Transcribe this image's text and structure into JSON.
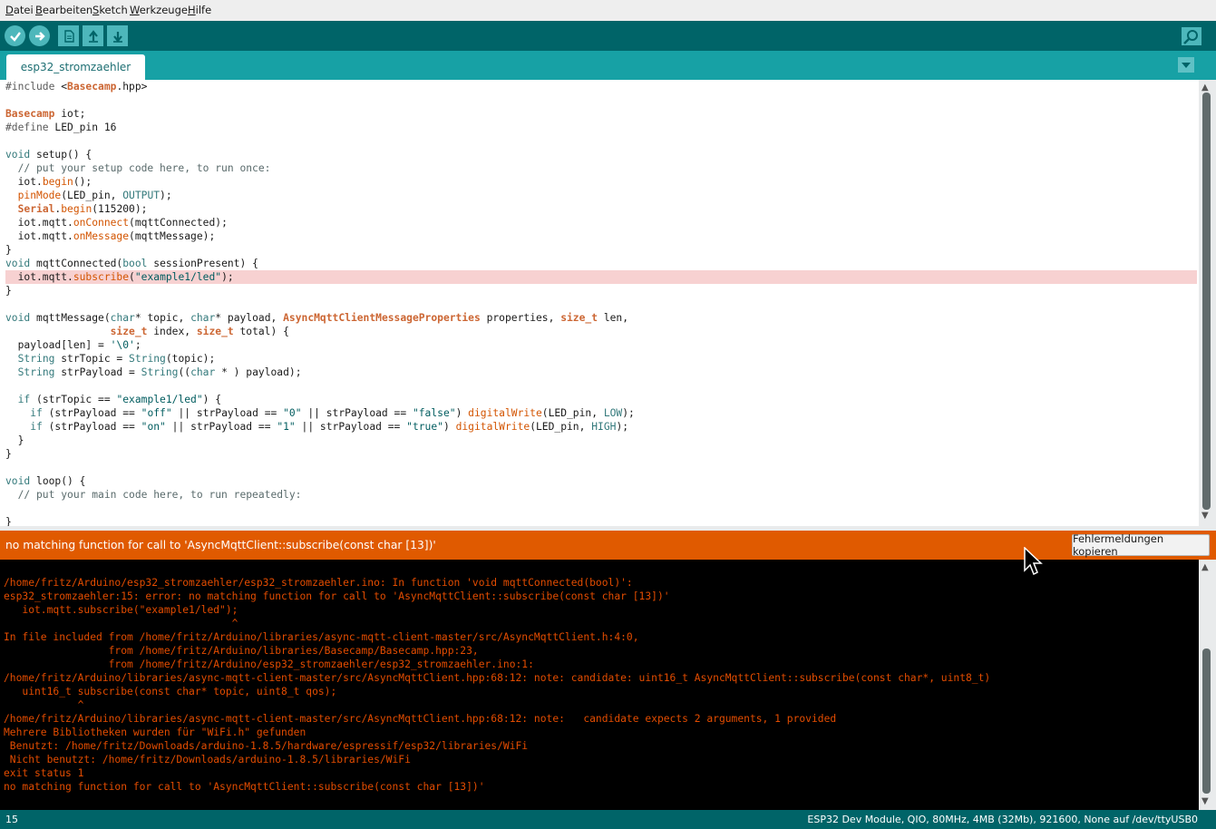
{
  "menu": [
    "Datei",
    "Bearbeiten",
    "Sketch",
    "Werkzeuge",
    "Hilfe"
  ],
  "toolbar": {
    "verify": "check-icon",
    "upload": "arrow-right-icon",
    "new": "new-file-icon",
    "open": "arrow-up-icon",
    "save": "arrow-down-icon",
    "serial_monitor": "magnifier-icon"
  },
  "tab": {
    "name": "esp32_stromzaehler"
  },
  "code": [
    "#include <Basecamp.hpp>",
    "",
    "Basecamp iot;",
    "#define LED_pin 16",
    "",
    "void setup() {",
    "  // put your setup code here, to run once:",
    "  iot.begin();",
    "  pinMode(LED_pin, OUTPUT);",
    "  Serial.begin(115200);",
    "  iot.mqtt.onConnect(mqttConnected);",
    "  iot.mqtt.onMessage(mqttMessage);",
    "}",
    "void mqttConnected(bool sessionPresent) {",
    "  iot.mqtt.subscribe(\"example1/led\");",
    "}",
    "",
    "void mqttMessage(char* topic, char* payload, AsyncMqttClientMessageProperties properties, size_t len,",
    "                 size_t index, size_t total) {",
    "  payload[len] = '\\0';",
    "  String strTopic = String(topic);",
    "  String strPayload = String((char * ) payload);",
    "",
    "  if (strTopic == \"example1/led\") {",
    "    if (strPayload == \"off\" || strPayload == \"0\" || strPayload == \"false\") digitalWrite(LED_pin, LOW);",
    "    if (strPayload == \"on\" || strPayload == \"1\" || strPayload == \"true\") digitalWrite(LED_pin, HIGH);",
    "  }",
    "}",
    "",
    "void loop() {",
    "  // put your main code here, to run repeatedly:",
    "",
    "}"
  ],
  "highlighted_line": 14,
  "error": {
    "message": "no matching function for call to 'AsyncMqttClient::subscribe(const char [13])'",
    "copy_button": "Fehlermeldungen kopieren"
  },
  "console": [
    "",
    "/home/fritz/Arduino/esp32_stromzaehler/esp32_stromzaehler.ino: In function 'void mqttConnected(bool)':",
    "esp32_stromzaehler:15: error: no matching function for call to 'AsyncMqttClient::subscribe(const char [13])'",
    "   iot.mqtt.subscribe(\"example1/led\");",
    "                                     ^",
    "In file included from /home/fritz/Arduino/libraries/async-mqtt-client-master/src/AsyncMqttClient.h:4:0,",
    "                 from /home/fritz/Arduino/libraries/Basecamp/Basecamp.hpp:23,",
    "                 from /home/fritz/Arduino/esp32_stromzaehler/esp32_stromzaehler.ino:1:",
    "/home/fritz/Arduino/libraries/async-mqtt-client-master/src/AsyncMqttClient.hpp:68:12: note: candidate: uint16_t AsyncMqttClient::subscribe(const char*, uint8_t)",
    "   uint16_t subscribe(const char* topic, uint8_t qos);",
    "            ^",
    "/home/fritz/Arduino/libraries/async-mqtt-client-master/src/AsyncMqttClient.hpp:68:12: note:   candidate expects 2 arguments, 1 provided",
    "Mehrere Bibliotheken wurden für \"WiFi.h\" gefunden",
    " Benutzt: /home/fritz/Downloads/arduino-1.8.5/hardware/espressif/esp32/libraries/WiFi",
    " Nicht benutzt: /home/fritz/Downloads/arduino-1.8.5/libraries/WiFi",
    "exit status 1",
    "no matching function for call to 'AsyncMqttClient::subscribe(const char [13])'"
  ],
  "status": {
    "line": "15",
    "board": "ESP32 Dev Module, QIO, 80MHz, 4MB (32Mb), 921600, None auf /dev/ttyUSB0"
  },
  "colors": {
    "toolbar": "#006468",
    "tabbar": "#17a1a5",
    "error_bar": "#e05a00",
    "console_text": "#e34c00"
  }
}
